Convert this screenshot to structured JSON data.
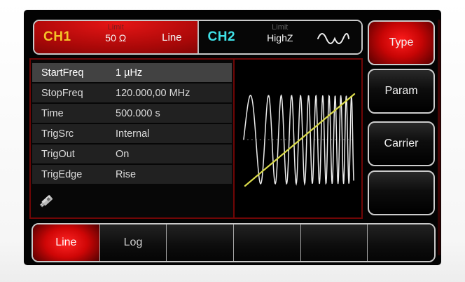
{
  "header": {
    "ch1": {
      "label": "CH1",
      "limit_label": "Limit",
      "limit_value": "50 Ω",
      "sweep_type": "Line"
    },
    "ch2": {
      "label": "CH2",
      "limit_label": "Limit",
      "limit_value": "HighZ",
      "waveform_icon": "sine-icon"
    }
  },
  "params": {
    "rows": [
      {
        "label": "StartFreq",
        "value": "1 µHz",
        "selected": true
      },
      {
        "label": "StopFreq",
        "value": "120.000,00 MHz",
        "selected": false
      },
      {
        "label": "Time",
        "value": "500.000 s",
        "selected": false
      },
      {
        "label": "TrigSrc",
        "value": "Internal",
        "selected": false
      },
      {
        "label": "TrigOut",
        "value": "On",
        "selected": false
      },
      {
        "label": "TrigEdge",
        "value": "Rise",
        "selected": false
      }
    ],
    "usb_icon": "usb-drive-icon"
  },
  "side_menu": [
    {
      "label": "Type",
      "active": true
    },
    {
      "label": "Param",
      "active": false
    },
    {
      "label": "Carrier",
      "active": false
    },
    {
      "label": "",
      "active": false
    }
  ],
  "bottom_menu": [
    {
      "label": "Line",
      "active": true
    },
    {
      "label": "Log",
      "active": false
    },
    {
      "label": "",
      "active": false
    },
    {
      "label": "",
      "active": false
    },
    {
      "label": "",
      "active": false
    },
    {
      "label": "",
      "active": false
    }
  ],
  "waveform": {
    "type": "sweep-chirp",
    "trace_color": "#ececec",
    "ramp_color": "#dada4a",
    "centerline_color": "#6f6f6f"
  },
  "colors": {
    "accent_red": "#c70505",
    "ch1_yellow": "#f4c428",
    "ch2_cyan": "#3fe0e6",
    "panel_border_red": "#700606",
    "button_border_gray": "#cccccc"
  }
}
